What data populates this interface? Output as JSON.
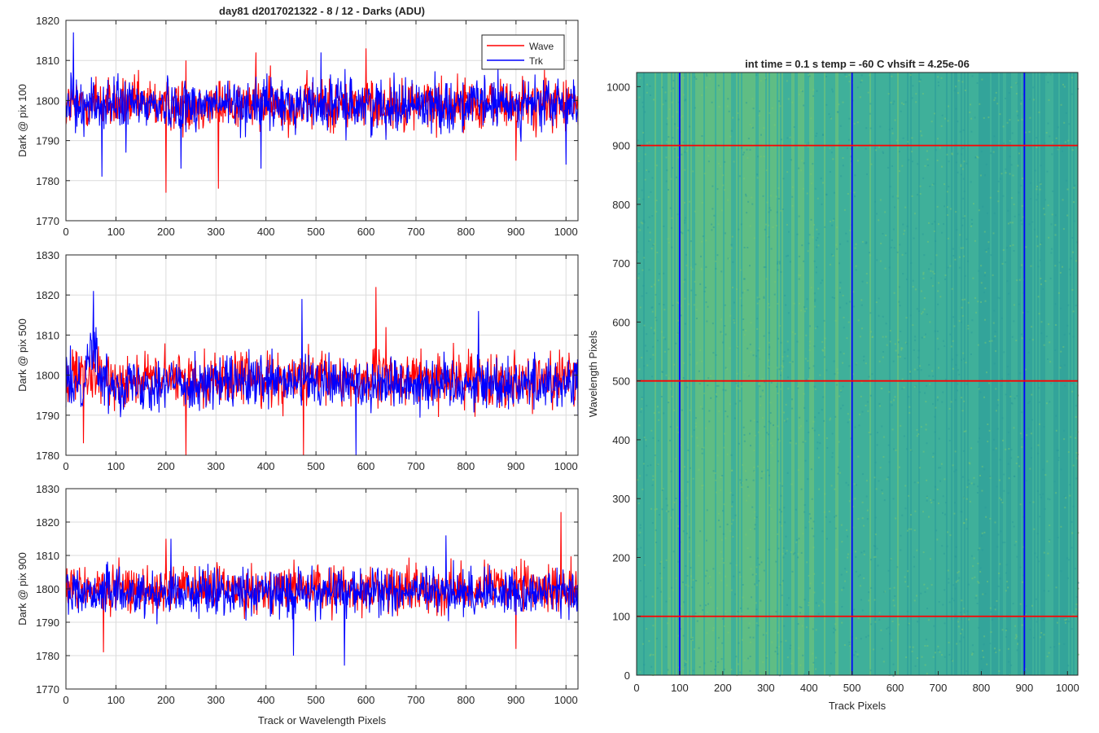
{
  "chart_data": [
    {
      "type": "line",
      "title": "day81 d2017021322 - 8 / 12 - Darks (ADU)",
      "xlabel": "",
      "ylabel": "Dark @ pix 100",
      "xlim": [
        0,
        1024
      ],
      "ylim": [
        1770,
        1820
      ],
      "x_ticks": [
        0,
        100,
        200,
        300,
        400,
        500,
        600,
        700,
        800,
        900,
        1000
      ],
      "y_ticks": [
        1770,
        1780,
        1790,
        1800,
        1810,
        1820
      ],
      "grid": true,
      "legend": {
        "placement": "top-right",
        "entries": [
          "Wave",
          "Trk"
        ]
      },
      "series": [
        {
          "name": "Wave",
          "color": "#ff0000",
          "mean": 1799,
          "spread": 4.2,
          "points": [
            [
              0,
              1794
            ],
            [
              60,
              1806
            ],
            [
              200,
              1777
            ],
            [
              240,
              1810
            ],
            [
              305,
              1778
            ],
            [
              380,
              1812
            ],
            [
              600,
              1813
            ],
            [
              900,
              1785
            ],
            [
              1024,
              1794
            ]
          ]
        },
        {
          "name": "Trk",
          "color": "#0000ff",
          "mean": 1799,
          "spread": 4.2,
          "points": [
            [
              0,
              1796
            ],
            [
              15,
              1817
            ],
            [
              72,
              1781
            ],
            [
              120,
              1787
            ],
            [
              230,
              1783
            ],
            [
              390,
              1783
            ],
            [
              510,
              1812
            ],
            [
              1000,
              1784
            ],
            [
              1024,
              1798
            ]
          ]
        }
      ]
    },
    {
      "type": "line",
      "title": "",
      "xlabel": "",
      "ylabel": "Dark @ pix 500",
      "xlim": [
        0,
        1024
      ],
      "ylim": [
        1780,
        1830
      ],
      "x_ticks": [
        0,
        100,
        200,
        300,
        400,
        500,
        600,
        700,
        800,
        900,
        1000
      ],
      "y_ticks": [
        1780,
        1790,
        1800,
        1810,
        1820,
        1830
      ],
      "grid": true,
      "series": [
        {
          "name": "Wave",
          "color": "#ff0000",
          "mean": 1799,
          "spread": 4.3,
          "points": [
            [
              0,
              1800
            ],
            [
              35,
              1783
            ],
            [
              240,
              1780
            ],
            [
              475,
              1780
            ],
            [
              620,
              1822
            ],
            [
              640,
              1812
            ],
            [
              1024,
              1797
            ]
          ]
        },
        {
          "name": "Trk",
          "color": "#0000ff",
          "mean": 1798,
          "spread": 4.3,
          "points": [
            [
              0,
              1792
            ],
            [
              55,
              1821
            ],
            [
              60,
              1812
            ],
            [
              472,
              1819
            ],
            [
              580,
              1780
            ],
            [
              825,
              1816
            ],
            [
              1024,
              1790
            ]
          ]
        }
      ]
    },
    {
      "type": "line",
      "title": "",
      "xlabel": "Track or Wavelength Pixels",
      "ylabel": "Dark @ pix 900",
      "xlim": [
        0,
        1024
      ],
      "ylim": [
        1770,
        1830
      ],
      "x_ticks": [
        0,
        100,
        200,
        300,
        400,
        500,
        600,
        700,
        800,
        900,
        1000
      ],
      "y_ticks": [
        1770,
        1780,
        1790,
        1800,
        1810,
        1820,
        1830
      ],
      "grid": true,
      "series": [
        {
          "name": "Wave",
          "color": "#ff0000",
          "mean": 1800,
          "spread": 4.5,
          "points": [
            [
              0,
              1798
            ],
            [
              75,
              1781
            ],
            [
              200,
              1815
            ],
            [
              900,
              1782
            ],
            [
              990,
              1823
            ],
            [
              1024,
              1799
            ]
          ]
        },
        {
          "name": "Trk",
          "color": "#0000ff",
          "mean": 1799,
          "spread": 4.5,
          "points": [
            [
              0,
              1803
            ],
            [
              210,
              1815
            ],
            [
              455,
              1780
            ],
            [
              557,
              1777
            ],
            [
              760,
              1816
            ],
            [
              1024,
              1798
            ]
          ]
        }
      ]
    },
    {
      "type": "heatmap",
      "title": "int time = 0.1 s   temp = -60 C   vhsift = 4.25e-06",
      "xlabel": "Track Pixels",
      "ylabel": "Wavelength Pixels",
      "xlim": [
        0,
        1024
      ],
      "ylim": [
        0,
        1024
      ],
      "x_ticks": [
        0,
        100,
        200,
        300,
        400,
        500,
        600,
        700,
        800,
        900,
        1000
      ],
      "y_ticks": [
        0,
        100,
        200,
        300,
        400,
        500,
        600,
        700,
        800,
        900,
        1000
      ],
      "colormap": [
        "#2a9a9a",
        "#3fb09a",
        "#7ac872"
      ],
      "vertical_lines": {
        "x": [
          100,
          500,
          900
        ],
        "color": "#0000ff"
      },
      "horizontal_lines": {
        "y": [
          100,
          500,
          900
        ],
        "color": "#ff0000"
      }
    }
  ]
}
